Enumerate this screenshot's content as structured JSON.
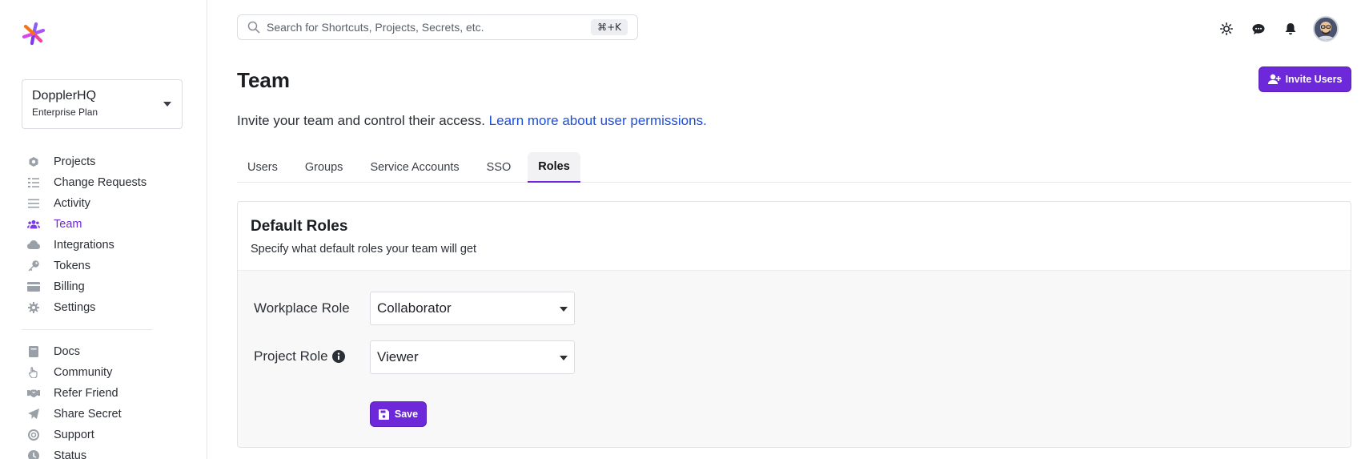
{
  "brand": {
    "accent": "#6d28d9",
    "link": "#1d4ed8"
  },
  "org": {
    "name": "DopplerHQ",
    "plan": "Enterprise Plan"
  },
  "search": {
    "placeholder": "Search for Shortcuts, Projects, Secrets, etc.",
    "shortcut": "⌘+K"
  },
  "sidebar": {
    "primary": [
      {
        "label": "Projects",
        "icon": "hexagon-icon"
      },
      {
        "label": "Change Requests",
        "icon": "checklist-icon"
      },
      {
        "label": "Activity",
        "icon": "lines-icon"
      },
      {
        "label": "Team",
        "icon": "users-icon",
        "active": true
      },
      {
        "label": "Integrations",
        "icon": "cloud-icon"
      },
      {
        "label": "Tokens",
        "icon": "key-icon"
      },
      {
        "label": "Billing",
        "icon": "credit-card-icon"
      },
      {
        "label": "Settings",
        "icon": "gear-icon"
      }
    ],
    "secondary": [
      {
        "label": "Docs",
        "icon": "book-icon"
      },
      {
        "label": "Community",
        "icon": "hand-icon"
      },
      {
        "label": "Refer Friend",
        "icon": "handshake-icon"
      },
      {
        "label": "Share Secret",
        "icon": "paper-plane-icon"
      },
      {
        "label": "Support",
        "icon": "lifebuoy-icon"
      },
      {
        "label": "Status",
        "icon": "clock-icon"
      }
    ]
  },
  "header": {
    "title": "Team",
    "invite_label": "Invite Users"
  },
  "intro": {
    "text": "Invite your team and control their access.",
    "link": "Learn more about user permissions."
  },
  "tabs": [
    {
      "label": "Users"
    },
    {
      "label": "Groups"
    },
    {
      "label": "Service Accounts"
    },
    {
      "label": "SSO"
    },
    {
      "label": "Roles",
      "active": true
    }
  ],
  "default_roles": {
    "title": "Default Roles",
    "description": "Specify what default roles your team will get",
    "workplace_label": "Workplace Role",
    "workplace_value": "Collaborator",
    "project_label": "Project Role",
    "project_value": "Viewer",
    "save_label": "Save"
  }
}
